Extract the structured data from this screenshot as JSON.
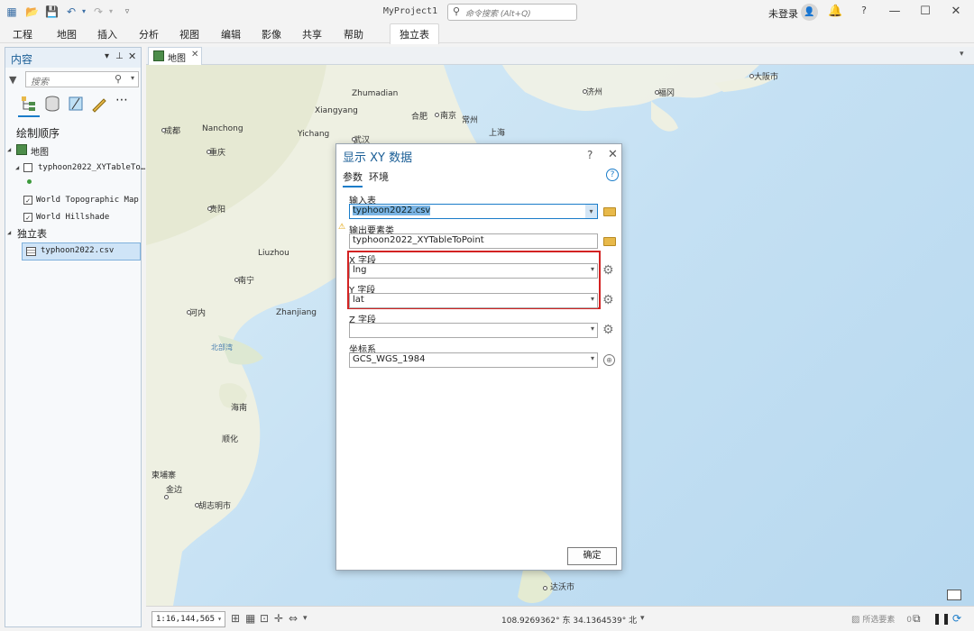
{
  "window": {
    "project_title": "MyProject1",
    "command_search_placeholder": "命令搜索 (Alt+Q)",
    "user": "未登录",
    "controls": [
      "?",
      "—",
      "☐",
      "✕"
    ]
  },
  "ribbon": {
    "tabs": [
      "工程",
      "地图",
      "插入",
      "分析",
      "视图",
      "编辑",
      "影像",
      "共享",
      "帮助"
    ],
    "context_tab": "独立表"
  },
  "contents": {
    "title": "内容",
    "search_placeholder": "搜索",
    "draw_order": "绘制顺序",
    "map_node": "地图",
    "layers": [
      {
        "name": "typhoon2022_XYTableTo…",
        "checked": false
      },
      {
        "name": "World Topographic Map",
        "checked": true
      },
      {
        "name": "World Hillshade",
        "checked": true
      }
    ],
    "standalone_heading": "独立表",
    "standalone_table": "typhoon2022.csv"
  },
  "view": {
    "tab_label": "地图",
    "map_labels": [
      "Zhumadian",
      "Xiangyang",
      "合肥",
      "南京",
      "常州",
      "上海",
      "成都",
      "Nanchong",
      "Yichang",
      "武汉",
      "重庆",
      "贵阳",
      "Liuzhou",
      "南宁",
      "Zhanjiang",
      "河内",
      "北部湾",
      "海南",
      "顺化",
      "柬埔寨",
      "金边",
      "胡志明市",
      "济州",
      "福冈",
      "大阪市",
      "达沃市"
    ]
  },
  "status": {
    "scale": "1:16,144,565",
    "coords": "108.9269362° 东  34.1364539° 北",
    "selected_label": "所选要素",
    "selected_count": "0"
  },
  "dialog": {
    "title": "显示 XY 数据",
    "tabs": [
      "参数",
      "环境"
    ],
    "input_table_label": "输入表",
    "input_table_value": "typhoon2022.csv",
    "output_label": "输出要素类",
    "output_value": "typhoon2022_XYTableToPoint",
    "x_label": "X 字段",
    "x_value": "lng",
    "y_label": "Y 字段",
    "y_value": "lat",
    "z_label": "Z 字段",
    "z_value": "",
    "cs_label": "坐标系",
    "cs_value": "GCS_WGS_1984",
    "ok_label": "确定"
  },
  "colors": {
    "accent": "#1a7cc9",
    "highlight_box": "#d32222",
    "selected_row": "#cfe4f7"
  }
}
